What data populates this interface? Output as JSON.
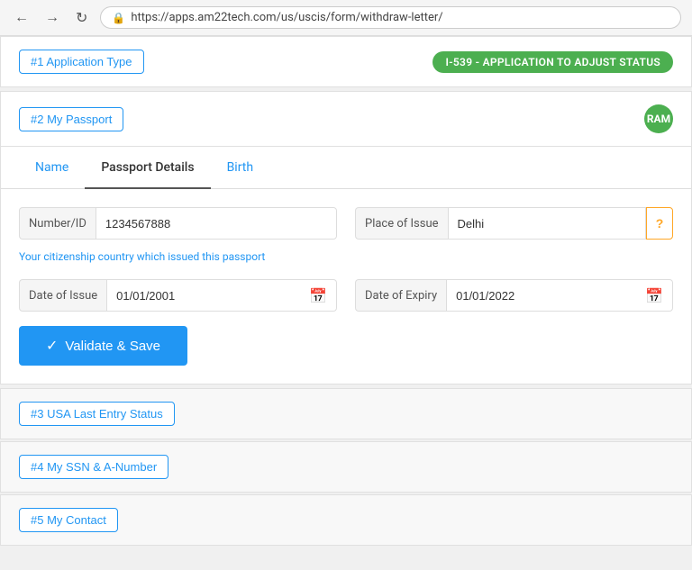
{
  "browser": {
    "url": "https://apps.am22tech.com/us/uscis/form/withdraw-letter/"
  },
  "sections": [
    {
      "id": "section1",
      "tag": "#1 Application Type",
      "badge": "I-539 - APPLICATION TO ADJUST STATUS",
      "badgeType": "green-wide"
    },
    {
      "id": "section2",
      "tag": "#2 My Passport",
      "badge": "RAM",
      "badgeType": "green-circle"
    }
  ],
  "tabs": [
    {
      "id": "name",
      "label": "Name",
      "active": false
    },
    {
      "id": "passport-details",
      "label": "Passport Details",
      "active": true
    },
    {
      "id": "birth",
      "label": "Birth",
      "active": false
    }
  ],
  "passport_form": {
    "number_label": "Number/ID",
    "number_value": "1234567888",
    "place_of_issue_label": "Place of Issue",
    "place_of_issue_value": "Delhi",
    "citizenship_note": "Your citizenship country which issued this passport",
    "date_of_issue_label": "Date of Issue",
    "date_of_issue_value": "01/01/2001",
    "date_of_expiry_label": "Date of Expiry",
    "date_of_expiry_value": "01/01/2022",
    "validate_label": "Validate & Save"
  },
  "bottom_sections": [
    {
      "id": "section3",
      "tag": "#3 USA Last Entry Status"
    },
    {
      "id": "section4",
      "tag": "#4 My SSN & A-Number"
    },
    {
      "id": "section5",
      "tag": "#5 My Contact"
    }
  ]
}
